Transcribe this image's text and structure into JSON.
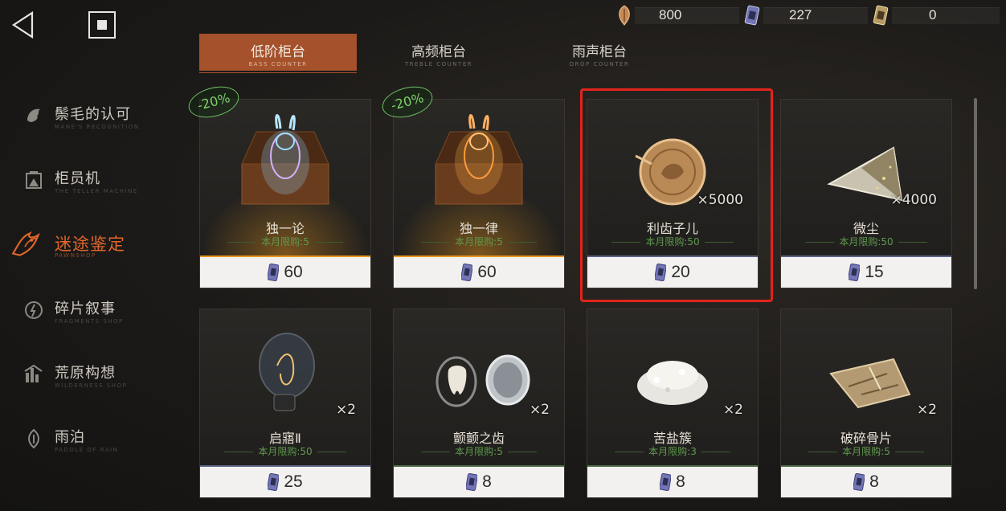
{
  "nav": {
    "back_icon": "back-triangle-icon",
    "stop_icon": "stop-square-icon"
  },
  "currencies": [
    {
      "icon": "pick-icon",
      "value": "800"
    },
    {
      "icon": "ticket-icon",
      "value": "227"
    },
    {
      "icon": "gold-ticket-icon",
      "value": "0"
    }
  ],
  "tabs": [
    {
      "cn": "低阶柜台",
      "en": "BASS COUNTER",
      "active": true
    },
    {
      "cn": "高频柜台",
      "en": "TREBLE COUNTER",
      "active": false
    },
    {
      "cn": "雨声柜台",
      "en": "DROP COUNTER",
      "active": false
    }
  ],
  "sidebar": [
    {
      "cn": "鬃毛的认可",
      "en": "MANE'S RECOGNITION",
      "icon": "mane-icon",
      "active": false
    },
    {
      "cn": "柜员机",
      "en": "THE TELLER MACHINE",
      "icon": "teller-machine-icon",
      "active": false
    },
    {
      "cn": "迷途鉴定",
      "en": "PAWNSHOP",
      "icon": "pawnshop-icon",
      "active": true
    },
    {
      "cn": "碎片叙事",
      "en": "FRAGMENTS SHOP",
      "icon": "fragments-icon",
      "active": false
    },
    {
      "cn": "荒原构想",
      "en": "WILDERNESS SHOP",
      "icon": "wilderness-icon",
      "active": false
    },
    {
      "cn": "雨泊",
      "en": "PADDLE OF RAIN",
      "icon": "rain-icon",
      "active": false
    }
  ],
  "items": [
    {
      "name": "独一论",
      "limit": "本月限购:5",
      "price": "60",
      "qty": "",
      "discount": "-20%",
      "art": "rabbit-chest-blue",
      "stripe": "#e8961f"
    },
    {
      "name": "独一律",
      "limit": "本月限购:5",
      "price": "60",
      "qty": "",
      "discount": "-20%",
      "art": "rabbit-chest-gold",
      "stripe": "#e8961f"
    },
    {
      "name": "利齿子儿",
      "limit": "本月限购:50",
      "price": "20",
      "qty": "×5000",
      "discount": "",
      "art": "coin",
      "stripe": "#5a6286"
    },
    {
      "name": "微尘",
      "limit": "本月限购:50",
      "price": "15",
      "qty": "×4000",
      "discount": "",
      "art": "shard",
      "stripe": "#5a6286"
    },
    {
      "name": "启寤Ⅱ",
      "limit": "本月限购:50",
      "price": "25",
      "qty": "×2",
      "discount": "",
      "art": "bulb",
      "stripe": "#5a6286"
    },
    {
      "name": "颤颤之齿",
      "limit": "本月限购:5",
      "price": "8",
      "qty": "×2",
      "discount": "",
      "art": "tooth",
      "stripe": "#4b6a44"
    },
    {
      "name": "苦盐簇",
      "limit": "本月限购:3",
      "price": "8",
      "qty": "×2",
      "discount": "",
      "art": "salt",
      "stripe": "#4b6a44"
    },
    {
      "name": "破碎骨片",
      "limit": "本月限购:5",
      "price": "8",
      "qty": "×2",
      "discount": "",
      "art": "bone",
      "stripe": "#4b6a44"
    }
  ]
}
